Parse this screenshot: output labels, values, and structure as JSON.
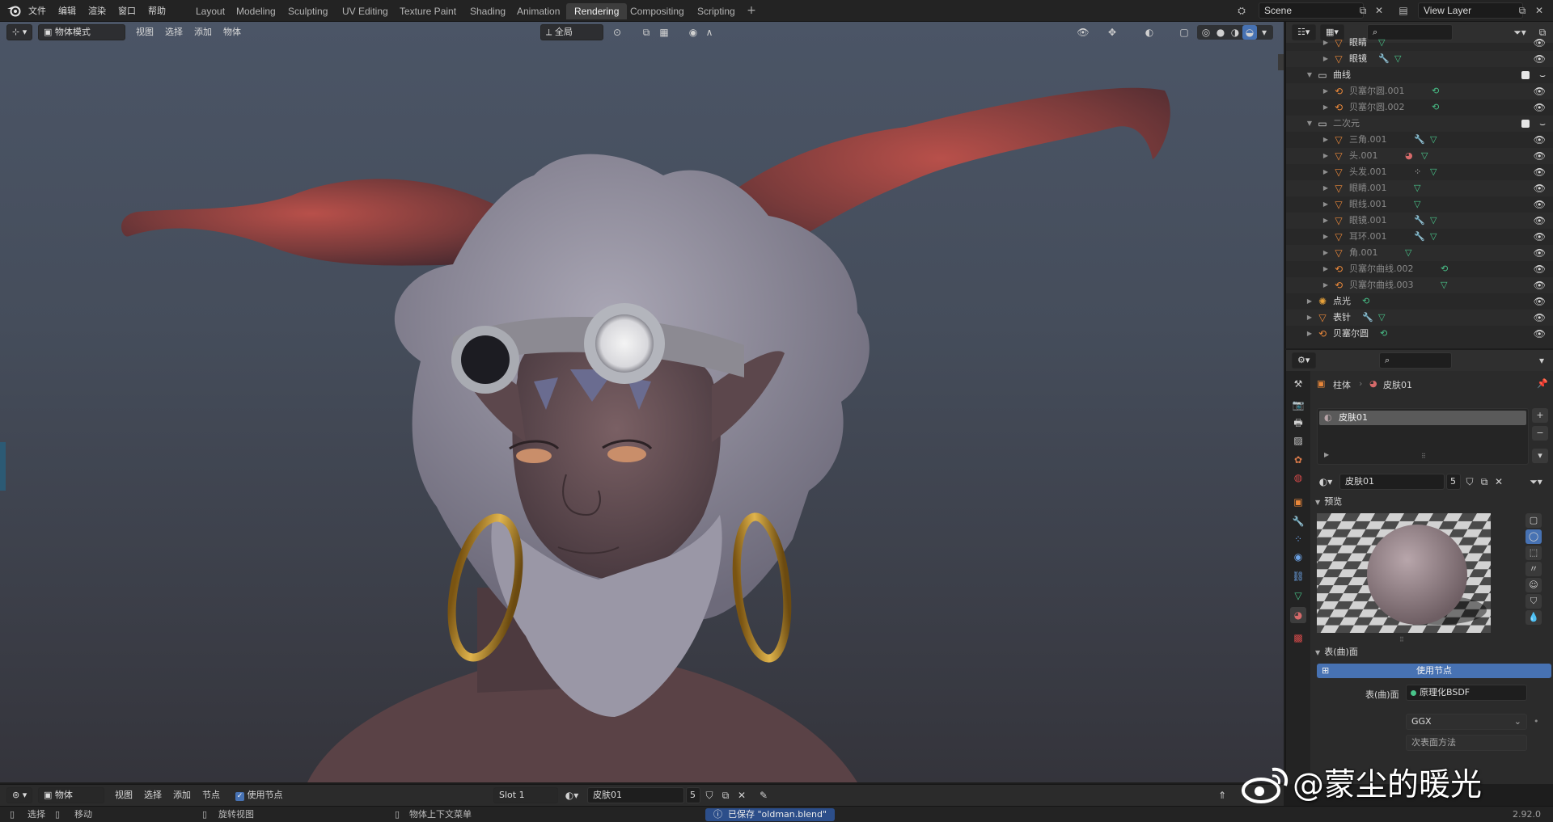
{
  "app": {
    "version": "2.92.0",
    "menu": [
      "文件",
      "编辑",
      "渲染",
      "窗口",
      "帮助"
    ],
    "workspaces": [
      "Layout",
      "Modeling",
      "Sculpting",
      "UV Editing",
      "Texture Paint",
      "Shading",
      "Animation",
      "Rendering",
      "Compositing",
      "Scripting"
    ],
    "active_workspace": "Rendering",
    "scene": "Scene",
    "view_layer": "View Layer"
  },
  "viewport": {
    "mode": "物体模式",
    "menus": [
      "视图",
      "选择",
      "添加",
      "物体"
    ],
    "transform_orientation": "全局",
    "overlay_icons": [
      "eye-icon",
      "gizmo-icon",
      "overlay-icon",
      "xray-icon"
    ],
    "shading_modes": [
      "wireframe",
      "solid",
      "material-preview",
      "rendered"
    ],
    "active_shading": "rendered"
  },
  "node_editor": {
    "type": "物体",
    "menus": [
      "视图",
      "选择",
      "添加",
      "节点"
    ],
    "use_nodes_label": "使用节点",
    "use_nodes": true,
    "slot": "Slot 1",
    "material": "皮肤01",
    "users": "5"
  },
  "statusbar": {
    "select": "选择",
    "move": "移动",
    "rotate": "旋转视图",
    "context_menu": "物体上下文菜单",
    "message": "已保存 \"oldman.blend\"",
    "version": "2.92.0"
  },
  "outliner": {
    "rows": [
      {
        "label": "眼睛",
        "indent": 2,
        "type": "mesh",
        "dim": false,
        "mods": [
          "mesh"
        ],
        "partial": true
      },
      {
        "label": "眼镜",
        "indent": 2,
        "type": "mesh",
        "dim": false,
        "mods": [
          "wrench",
          "mesh"
        ]
      },
      {
        "label": "曲线",
        "indent": 1,
        "type": "collection",
        "dim": false,
        "mods": [],
        "checked": true,
        "expanded": true
      },
      {
        "label": "贝塞尔圆.001",
        "indent": 2,
        "type": "curve",
        "dim": true,
        "mods": [
          "curve"
        ]
      },
      {
        "label": "贝塞尔圆.002",
        "indent": 2,
        "type": "curve",
        "dim": true,
        "mods": [
          "curve"
        ]
      },
      {
        "label": "二次元",
        "indent": 1,
        "type": "collection",
        "dim": true,
        "mods": [],
        "checked": true,
        "expanded": true
      },
      {
        "label": "三角.001",
        "indent": 2,
        "type": "mesh",
        "dim": true,
        "mods": [
          "wrench",
          "mesh"
        ]
      },
      {
        "label": "头.001",
        "indent": 2,
        "type": "mesh",
        "dim": true,
        "mods": [
          "material",
          "mesh"
        ]
      },
      {
        "label": "头发.001",
        "indent": 2,
        "type": "mesh",
        "dim": true,
        "mods": [
          "particles",
          "mesh"
        ]
      },
      {
        "label": "眼睛.001",
        "indent": 2,
        "type": "mesh",
        "dim": true,
        "mods": [
          "mesh"
        ]
      },
      {
        "label": "眼线.001",
        "indent": 2,
        "type": "mesh",
        "dim": true,
        "mods": [
          "mesh"
        ]
      },
      {
        "label": "眼镜.001",
        "indent": 2,
        "type": "mesh",
        "dim": true,
        "mods": [
          "wrench",
          "mesh"
        ]
      },
      {
        "label": "耳环.001",
        "indent": 2,
        "type": "mesh",
        "dim": true,
        "mods": [
          "wrench",
          "mesh"
        ]
      },
      {
        "label": "角.001",
        "indent": 2,
        "type": "mesh",
        "dim": true,
        "mods": [
          "mesh"
        ]
      },
      {
        "label": "贝塞尔曲线.002",
        "indent": 2,
        "type": "curve",
        "dim": true,
        "mods": [
          "curve"
        ]
      },
      {
        "label": "贝塞尔曲线.003",
        "indent": 2,
        "type": "curve",
        "dim": true,
        "mods": [
          "mesh"
        ]
      },
      {
        "label": "点光",
        "indent": 1,
        "type": "light",
        "dim": false,
        "mods": [
          "light-data"
        ]
      },
      {
        "label": "表针",
        "indent": 1,
        "type": "mesh",
        "dim": false,
        "mods": [
          "wrench",
          "mesh"
        ]
      },
      {
        "label": "贝塞尔圆",
        "indent": 1,
        "type": "curve",
        "dim": false,
        "mods": [
          "curve"
        ]
      }
    ]
  },
  "properties": {
    "breadcrumb_object": "柱体",
    "breadcrumb_material": "皮肤01",
    "material_slots": [
      "皮肤01"
    ],
    "material_name": "皮肤01",
    "material_users": "5",
    "preview_label": "预览",
    "surface_label": "表(曲)面",
    "use_nodes_button": "使用节点",
    "surface_field_label": "表(曲)面",
    "surface_shader": "原理化BSDF",
    "distribution": "GGX",
    "subsurface_partial": "次表面方法"
  },
  "watermark": "@蒙尘的暖光",
  "colors": {
    "accent_blue": "#4772b3",
    "active_tab": "#3d3d3d",
    "mesh_orange": "#e8873a",
    "modifier_blue": "#6da4e8",
    "data_green": "#49c48a"
  }
}
